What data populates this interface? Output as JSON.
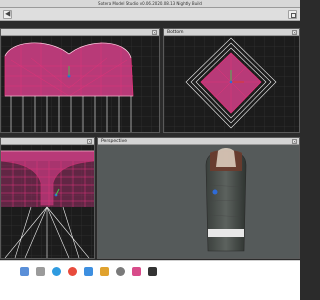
{
  "window": {
    "title": "Sotera Model Studio v0.06.2020.08.13 Nightly Build"
  },
  "viewports": {
    "top_left": {
      "label": ""
    },
    "top_right": {
      "label": "Bottom"
    },
    "bottom_left": {
      "label": ""
    },
    "bottom_right": {
      "label": "Perspective"
    }
  },
  "colors": {
    "wire_pink": "#e0337a",
    "wire_white": "#f2f2f2",
    "wire_fill": "#b83a78",
    "viewport_bg": "#1c1c1c",
    "perspective_bg": "#555a5a"
  },
  "taskbar": {
    "icons": [
      "finder-icon",
      "launchpad-icon",
      "safari-icon",
      "chrome-icon",
      "folder-icon",
      "model-studio-icon",
      "settings-icon",
      "preview-icon",
      "terminal-icon"
    ]
  }
}
